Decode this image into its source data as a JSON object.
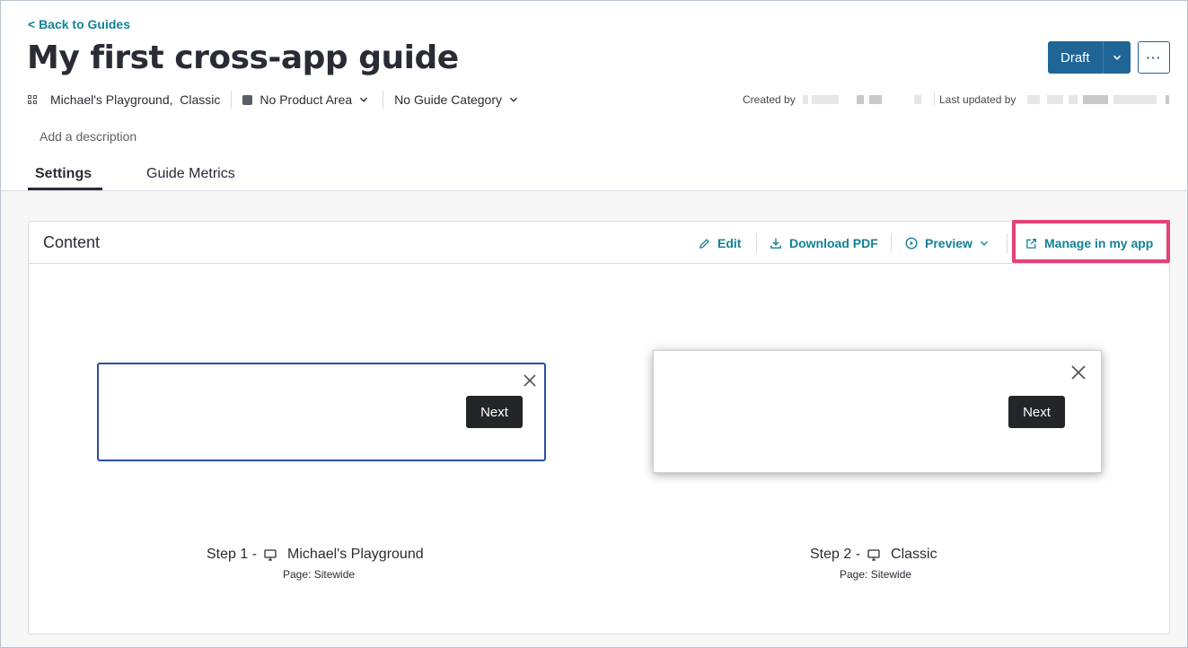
{
  "header": {
    "back_link": "< Back to Guides",
    "title": "My first cross-app guide",
    "status_button": "Draft",
    "more_button": "···",
    "apps": "Michael's Playground,  Classic",
    "product_area": "No Product Area",
    "guide_category": "No Guide Category",
    "created_by_label": "Created by",
    "last_updated_by_label": "Last updated by",
    "description_placeholder": "Add a description"
  },
  "tabs": [
    {
      "label": "Settings",
      "active": true
    },
    {
      "label": "Guide Metrics",
      "active": false
    }
  ],
  "content": {
    "title": "Content",
    "actions": {
      "edit": "Edit",
      "download_pdf": "Download PDF",
      "preview": "Preview",
      "manage_in_app": "Manage in my app"
    },
    "steps": [
      {
        "label": "Step 1 -",
        "app": "Michael's Playground",
        "page": "Page: Sitewide",
        "button": "Next"
      },
      {
        "label": "Step 2 -",
        "app": "Classic",
        "page": "Page: Sitewide",
        "button": "Next"
      }
    ]
  },
  "colors": {
    "accent": "#128297",
    "primary_button": "#1f6696",
    "highlight": "#e3427a",
    "step1_border": "#2b4ea2"
  },
  "icons": [
    "grid-icon",
    "chevron-down-icon",
    "pencil-icon",
    "download-icon",
    "play-circle-icon",
    "external-link-icon",
    "close-icon",
    "monitor-icon"
  ]
}
